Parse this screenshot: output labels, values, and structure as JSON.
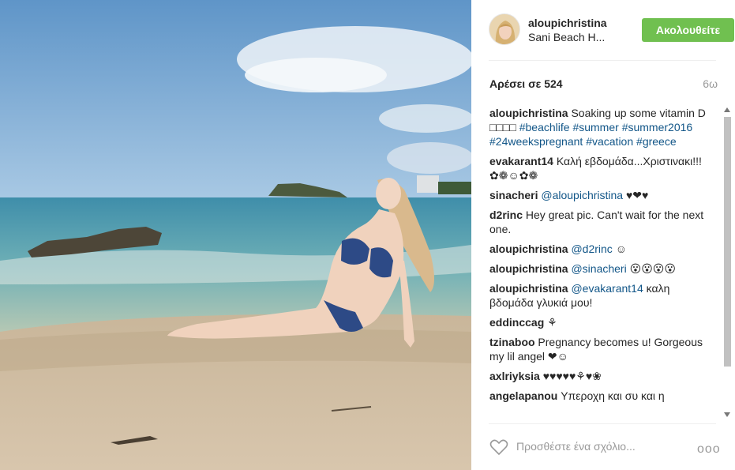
{
  "post": {
    "username": "aloupichristina",
    "location": "Sani Beach H...",
    "follow_label": "Ακολουθείτε",
    "likes_text": "Αρέσει σε 524",
    "age": "6ω"
  },
  "comments": [
    {
      "user": "aloupichristina",
      "parts": [
        {
          "t": "text",
          "v": " Soaking up some vitamin D □□□□ "
        },
        {
          "t": "tag",
          "v": "#beachlife"
        },
        {
          "t": "text",
          "v": " "
        },
        {
          "t": "tag",
          "v": "#summer"
        },
        {
          "t": "text",
          "v": " "
        },
        {
          "t": "tag",
          "v": "#summer2016"
        },
        {
          "t": "text",
          "v": " "
        },
        {
          "t": "tag",
          "v": "#24weekspregnant"
        },
        {
          "t": "text",
          "v": " "
        },
        {
          "t": "tag",
          "v": "#vacation"
        },
        {
          "t": "text",
          "v": " "
        },
        {
          "t": "tag",
          "v": "#greece"
        }
      ]
    },
    {
      "user": "evakarant14",
      "parts": [
        {
          "t": "text",
          "v": " Καλή εβδομάδα...Χριστινακι!!!✿❁☺✿❁"
        }
      ]
    },
    {
      "user": "sinacheri",
      "parts": [
        {
          "t": "text",
          "v": " "
        },
        {
          "t": "tag",
          "v": "@aloupichristina"
        },
        {
          "t": "text",
          "v": " ♥❤♥"
        }
      ]
    },
    {
      "user": "d2rinc",
      "parts": [
        {
          "t": "text",
          "v": " Hey great pic. Can't wait for the next one."
        }
      ]
    },
    {
      "user": "aloupichristina",
      "parts": [
        {
          "t": "text",
          "v": " "
        },
        {
          "t": "tag",
          "v": "@d2rinc"
        },
        {
          "t": "text",
          "v": " ☺"
        }
      ]
    },
    {
      "user": "aloupichristina",
      "parts": [
        {
          "t": "text",
          "v": " "
        },
        {
          "t": "tag",
          "v": "@sinacheri"
        },
        {
          "t": "text",
          "v": " 😮😮😮😮"
        }
      ]
    },
    {
      "user": "aloupichristina",
      "parts": [
        {
          "t": "text",
          "v": " "
        },
        {
          "t": "tag",
          "v": "@evakarant14"
        },
        {
          "t": "text",
          "v": " καλη βδομάδα γλυκιά μου!"
        }
      ]
    },
    {
      "user": "eddinccag",
      "parts": [
        {
          "t": "text",
          "v": " ⚘"
        }
      ]
    },
    {
      "user": "tzinaboo",
      "parts": [
        {
          "t": "text",
          "v": " Pregnancy becomes u! Gorgeous my lil angel ❤☺"
        }
      ]
    },
    {
      "user": "axlriyksia",
      "parts": [
        {
          "t": "text",
          "v": " ♥♥♥♥♥⚘♥❀"
        }
      ]
    },
    {
      "user": "angelapanou",
      "parts": [
        {
          "t": "text",
          "v": " Υπεροχη και συ και η"
        }
      ]
    }
  ],
  "footer": {
    "comment_placeholder": "Προσθέστε ένα σχόλιο...",
    "more_label": "ooo"
  },
  "colors": {
    "follow_button": "#70c050",
    "hashtag": "#125688"
  },
  "icons": {
    "like": "heart-outline-icon"
  }
}
